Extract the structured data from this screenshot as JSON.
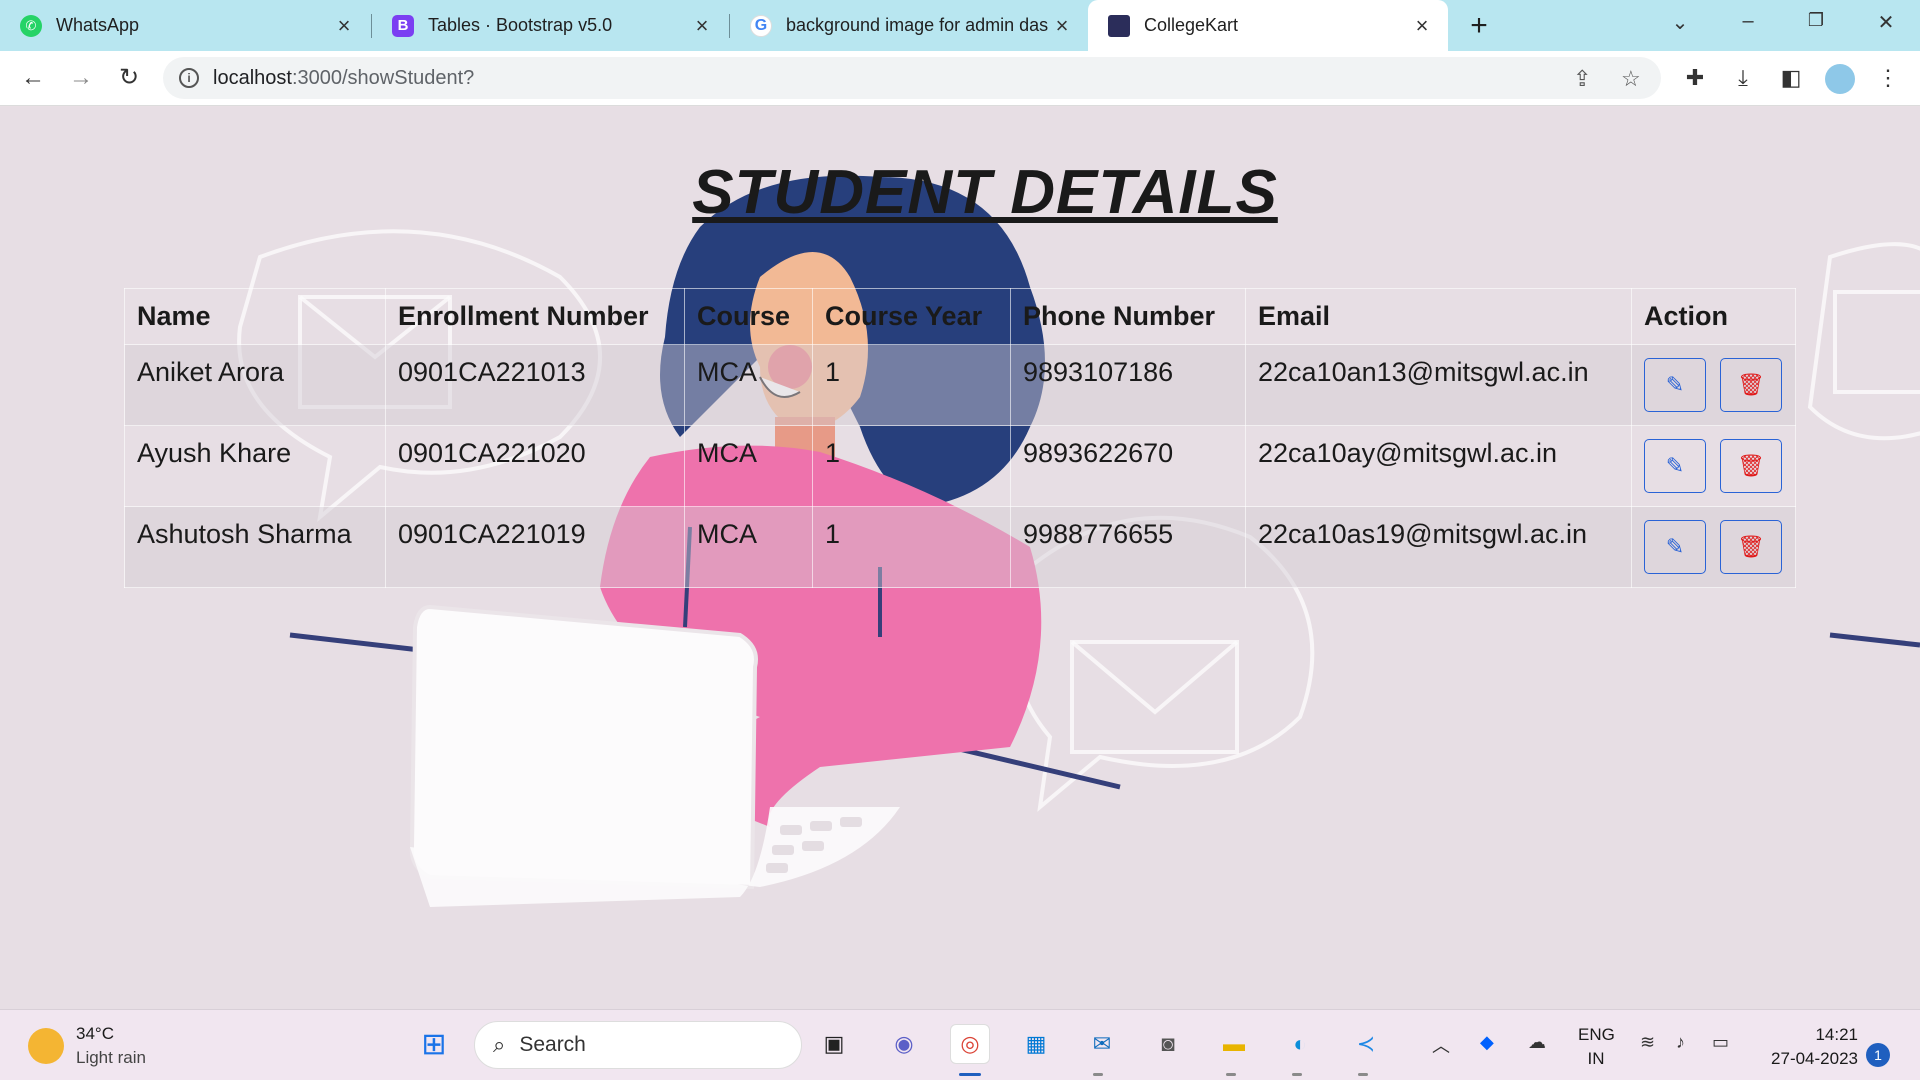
{
  "browser": {
    "tabs": [
      {
        "title": "WhatsApp",
        "active": false,
        "icon": "whatsapp-icon"
      },
      {
        "title": "Tables · Bootstrap v5.0",
        "active": false,
        "icon": "bootstrap-icon"
      },
      {
        "title": "background image for admin das",
        "active": false,
        "icon": "google-icon"
      },
      {
        "title": "CollegeKart",
        "active": true,
        "icon": "collegekart-icon"
      }
    ],
    "address": {
      "host": "localhost",
      "path": ":3000/showStudent?"
    }
  },
  "page": {
    "title": "STUDENT DETAILS",
    "table": {
      "columns": [
        "Name",
        "Enrollment Number",
        "Course",
        "Course Year",
        "Phone Number",
        "Email",
        "Action"
      ],
      "rows": [
        {
          "name": "Aniket Arora",
          "enrollment": "0901CA221013",
          "course": "MCA",
          "year": "1",
          "phone": "9893107186",
          "email": "22ca10an13@mitsgwl.ac.in"
        },
        {
          "name": "Ayush Khare",
          "enrollment": "0901CA221020",
          "course": "MCA",
          "year": "1",
          "phone": "9893622670",
          "email": "22ca10ay@mitsgwl.ac.in"
        },
        {
          "name": "Ashutosh Sharma",
          "enrollment": "0901CA221019",
          "course": "MCA",
          "year": "1",
          "phone": "9988776655",
          "email": "22ca10as19@mitsgwl.ac.in"
        }
      ]
    }
  },
  "taskbar": {
    "weather": {
      "temp": "34°C",
      "desc": "Light rain"
    },
    "search_label": "Search",
    "lang": {
      "line1": "ENG",
      "line2": "IN"
    },
    "clock": {
      "time": "14:21",
      "date": "27-04-2023"
    },
    "notification_count": "1"
  },
  "colors": {
    "accent": "#2a63d6",
    "delete": "#e01b1b",
    "tabstrip": "#b8e6f0"
  }
}
